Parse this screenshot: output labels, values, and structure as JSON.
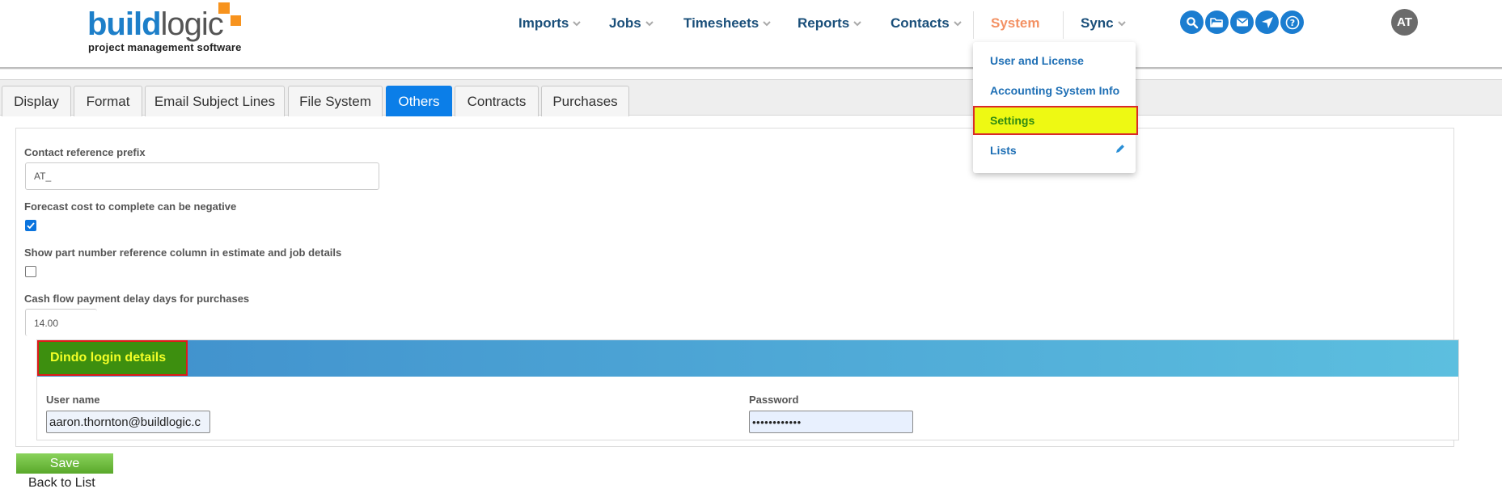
{
  "brand": {
    "name_bold": "build",
    "name_regular": "logic",
    "tagline": "project management software"
  },
  "nav": {
    "items": [
      {
        "label": "Imports"
      },
      {
        "label": "Jobs"
      },
      {
        "label": "Timesheets"
      },
      {
        "label": "Reports"
      },
      {
        "label": "Contacts"
      },
      {
        "label": "System",
        "active": true
      },
      {
        "label": "Sync"
      }
    ],
    "icons": [
      "search-icon",
      "folder-icon",
      "mail-icon",
      "send-icon",
      "help-icon"
    ],
    "avatar_initials": "AT"
  },
  "system_menu": {
    "items": [
      {
        "label": "User and License"
      },
      {
        "label": "Accounting System Info"
      },
      {
        "label": "Settings",
        "highlighted": true
      },
      {
        "label": "Lists"
      }
    ]
  },
  "tabs": [
    {
      "label": "Display"
    },
    {
      "label": "Format"
    },
    {
      "label": "Email Subject Lines"
    },
    {
      "label": "File System"
    },
    {
      "label": "Others",
      "active": true
    },
    {
      "label": "Contracts"
    },
    {
      "label": "Purchases"
    }
  ],
  "form": {
    "contact_prefix": {
      "label": "Contact reference prefix",
      "value": "AT_"
    },
    "forecast_negative": {
      "label": "Forecast cost to complete can be negative",
      "checked": true
    },
    "part_number_column": {
      "label": "Show part number reference column in estimate and job details",
      "checked": false
    },
    "cash_flow_delay": {
      "label": "Cash flow payment delay days for purchases",
      "value": "14.00"
    },
    "dindo": {
      "title": "Dindo login details",
      "username_label": "User name",
      "username_value": "aaron.thornton@buildlogic.c",
      "password_label": "Password",
      "password_value": "••••••••••••"
    },
    "save_label": "Save",
    "back_label": "Back to List"
  },
  "colors": {
    "brand_blue": "#1d7fc9",
    "brand_orange": "#f7931e",
    "nav_text": "#1a4f7a",
    "nav_active": "#f39163",
    "tab_active": "#0b7ee8",
    "highlight_fill": "#eef913",
    "highlight_border": "#d92a2a",
    "dindo_title_bg": "#3d8f0f",
    "save_green": "#59a82a"
  }
}
